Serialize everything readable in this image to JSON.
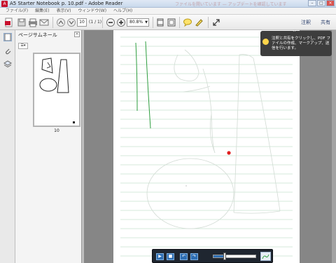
{
  "window": {
    "title": "A5 Starter Notebook p. 10.pdf - Adobe Reader",
    "background_notice": "ファイルを開いています — アップデートを確認しています"
  },
  "menu": {
    "items": [
      "ファイル(F)",
      "編集(E)",
      "表示(V)",
      "ウィンドウ(W)",
      "ヘルプ(H)"
    ]
  },
  "toolbar": {
    "page_number": "10",
    "page_total": "(1 / 1)",
    "zoom": "80.8%",
    "comment_label": "注釈",
    "share_label": "共有"
  },
  "thumbnails": {
    "title": "ページサムネール",
    "page_label": "10"
  },
  "tooltip": {
    "text": "注釈と共有をクリックし、PDF ファイルの作成、マークアップ、送信を行います。"
  },
  "playback": {
    "progress": 0.25
  },
  "colors": {
    "ruled_line": "#c9e3cf",
    "green_stroke": "#2e9e3f",
    "sketch_stroke": "#d2dbd4",
    "red_dot": "#e02020",
    "accent_blue": "#2f6fb3"
  },
  "icons": [
    "create-pdf-icon",
    "save-icon",
    "print-icon",
    "email-icon",
    "prev-page-icon",
    "next-page-icon",
    "zoom-out-icon",
    "zoom-in-icon",
    "fit-page-icon",
    "fit-width-icon",
    "comment-icon",
    "highlight-icon",
    "expand-icon",
    "thumbnails-icon",
    "attachments-icon",
    "layers-icon",
    "bulb-icon",
    "play-icon",
    "stop-icon",
    "undo-icon",
    "redo-icon",
    "pen-icon"
  ]
}
